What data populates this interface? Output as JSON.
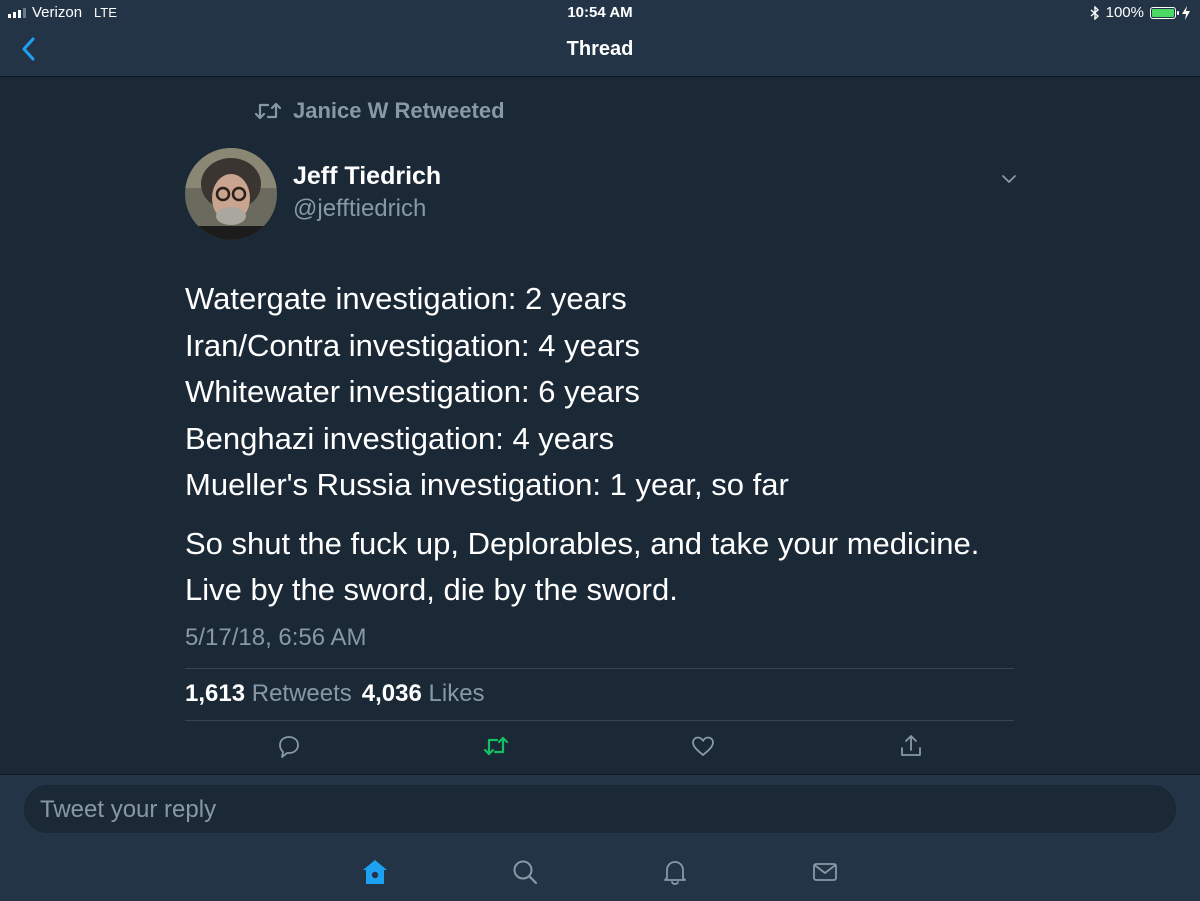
{
  "status_bar": {
    "carrier": "Verizon",
    "network": "LTE",
    "time": "10:54 AM",
    "battery": "100%",
    "battery_level": 1.0
  },
  "nav": {
    "title": "Thread",
    "back_icon": "chevron-left-icon"
  },
  "tweet": {
    "retweeted_by": "Janice W Retweeted",
    "author_name": "Jeff Tiedrich",
    "author_handle": "@jefftiedrich",
    "lines": [
      "Watergate investigation: 2 years",
      "Iran/Contra investigation: 4 years",
      "Whitewater investigation: 6 years",
      "Benghazi investigation: 4 years",
      "Mueller's Russia investigation: 1 year, so far"
    ],
    "lines2": [
      "So shut the fuck up, Deplorables, and take your medicine.",
      "Live by the sword, die by the sword."
    ],
    "timestamp": "5/17/18, 6:56 AM",
    "retweets_count": "1,613",
    "retweets_label": "Retweets",
    "likes_count": "4,036",
    "likes_label": "Likes"
  },
  "actions": [
    "reply-icon",
    "retweet-icon",
    "like-icon",
    "share-icon"
  ],
  "reply_placeholder": "Tweet your reply",
  "tabs": [
    "home-icon",
    "search-icon",
    "notifications-icon",
    "messages-icon"
  ],
  "colors": {
    "background": "#1b2836",
    "bar": "#243447",
    "accent": "#1da1f2",
    "retweet_green": "#17bf63",
    "muted": "#8899a6",
    "battery_green": "#4cd964"
  }
}
